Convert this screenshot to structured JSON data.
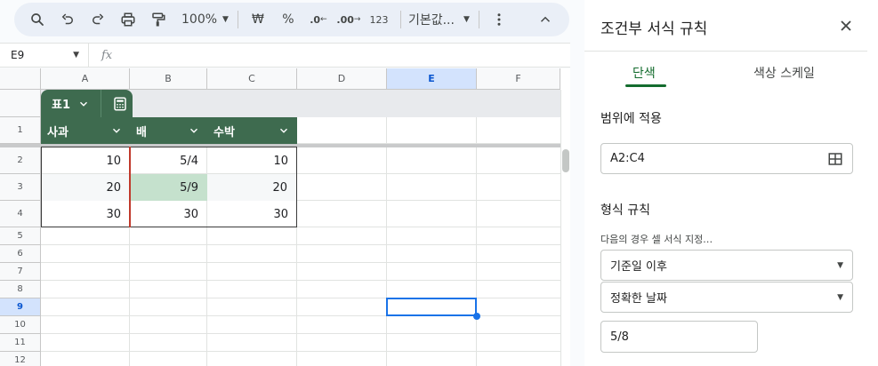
{
  "toolbar": {
    "zoom": "100%",
    "currency": "₩",
    "percent": "%",
    "decrease_decimal": ".0",
    "increase_decimal": ".00",
    "number_format": "123",
    "font": "기본값...",
    "icons": [
      "search-icon",
      "undo-icon",
      "redo-icon",
      "print-icon",
      "paint-format-icon",
      "more-vert-icon",
      "collapse-icon"
    ]
  },
  "formula_bar": {
    "cell_ref": "E9",
    "fx": "fx",
    "content": ""
  },
  "grid": {
    "columns": [
      "A",
      "B",
      "C",
      "D",
      "E",
      "F"
    ],
    "selected_column": "E",
    "rows": [
      "1",
      "2",
      "3",
      "4",
      "5",
      "6",
      "7",
      "8",
      "9",
      "10",
      "11",
      "12"
    ],
    "selected_row": "9",
    "table": {
      "name": "표1",
      "headers": [
        "사과",
        "배",
        "수박"
      ],
      "rows": [
        [
          "10",
          "5/4",
          "10"
        ],
        [
          "20",
          "5/9",
          "20"
        ],
        [
          "30",
          "30",
          "30"
        ]
      ],
      "highlight_color": "#c5e1cd",
      "header_color": "#3e6b4f"
    },
    "selected_cell": "E9"
  },
  "panel": {
    "title": "조건부 서식 규칙",
    "tabs": [
      "단색",
      "색상 스케일"
    ],
    "active_tab": "단색",
    "range_label": "범위에 적용",
    "range_value": "A2:C4",
    "format_rules_label": "형식 규칙",
    "condition_label": "다음의 경우 셀 서식 지정…",
    "condition_value": "기준일 이후",
    "date_option": "정확한 날짜",
    "date_value": "5/8",
    "accent_color": "#146c2e"
  }
}
